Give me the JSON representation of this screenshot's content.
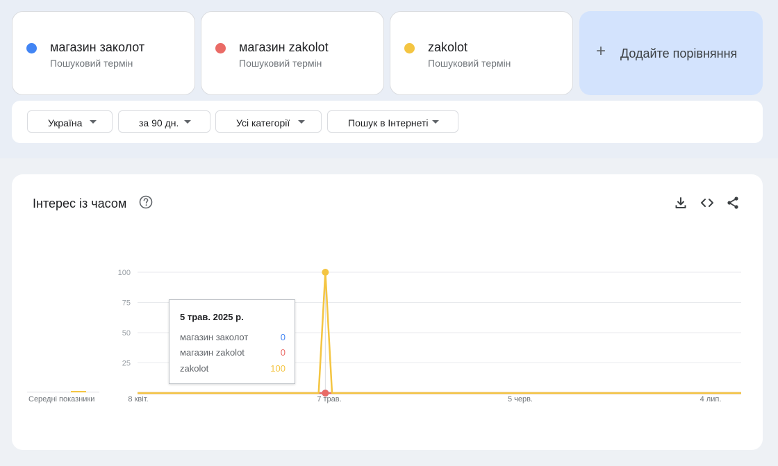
{
  "terms": [
    {
      "name": "магазин заколот",
      "subtitle": "Пошуковий термін",
      "color": "#4285f4"
    },
    {
      "name": "магазин zakolot",
      "subtitle": "Пошуковий термін",
      "color": "#ea6b66"
    },
    {
      "name": "zakolot",
      "subtitle": "Пошуковий термін",
      "color": "#f4c542"
    }
  ],
  "add_comparison": {
    "icon": "plus-icon",
    "label": "Додайте порівняння"
  },
  "filters": [
    {
      "label": "Україна"
    },
    {
      "label": "за 90 дн."
    },
    {
      "label": "Усі категорії"
    },
    {
      "label": "Пошук в Інтернеті"
    }
  ],
  "interest_card": {
    "title": "Інтерес із часом",
    "icons": [
      "help-icon",
      "download-icon",
      "embed-icon",
      "share-icon"
    ],
    "averages_label": "Середні показники"
  },
  "tooltip": {
    "date": "5 трав. 2025 р.",
    "rows": [
      {
        "name": "магазин заколот",
        "value": "0",
        "color": "#4285f4"
      },
      {
        "name": "магазин zakolot",
        "value": "0",
        "color": "#ea6b66"
      },
      {
        "name": "zakolot",
        "value": "100",
        "color": "#f4c542"
      }
    ]
  },
  "chart_data": {
    "type": "line",
    "x_tick_labels": [
      "8 квіт.",
      "7 трав.",
      "5 черв.",
      "4 лип."
    ],
    "x_range": [
      "2025-04-07",
      "2025-07-06"
    ],
    "y_ticks": [
      25,
      50,
      75,
      100
    ],
    "ylim": [
      0,
      100
    ],
    "grid": true,
    "series": [
      {
        "name": "магазин заколот",
        "color": "#4285f4",
        "points": [
          [
            "2025-04-07",
            0
          ],
          [
            "2025-07-06",
            0
          ]
        ]
      },
      {
        "name": "магазин zakolot",
        "color": "#ea6b66",
        "points": [
          [
            "2025-04-07",
            0
          ],
          [
            "2025-07-06",
            0
          ]
        ]
      },
      {
        "name": "zakolot",
        "color": "#f4c542",
        "points": [
          [
            "2025-04-07",
            0
          ],
          [
            "2025-05-04",
            0
          ],
          [
            "2025-05-05",
            100
          ],
          [
            "2025-05-06",
            0
          ],
          [
            "2025-07-06",
            0
          ]
        ]
      }
    ],
    "highlight": {
      "x": "2025-05-05"
    }
  }
}
